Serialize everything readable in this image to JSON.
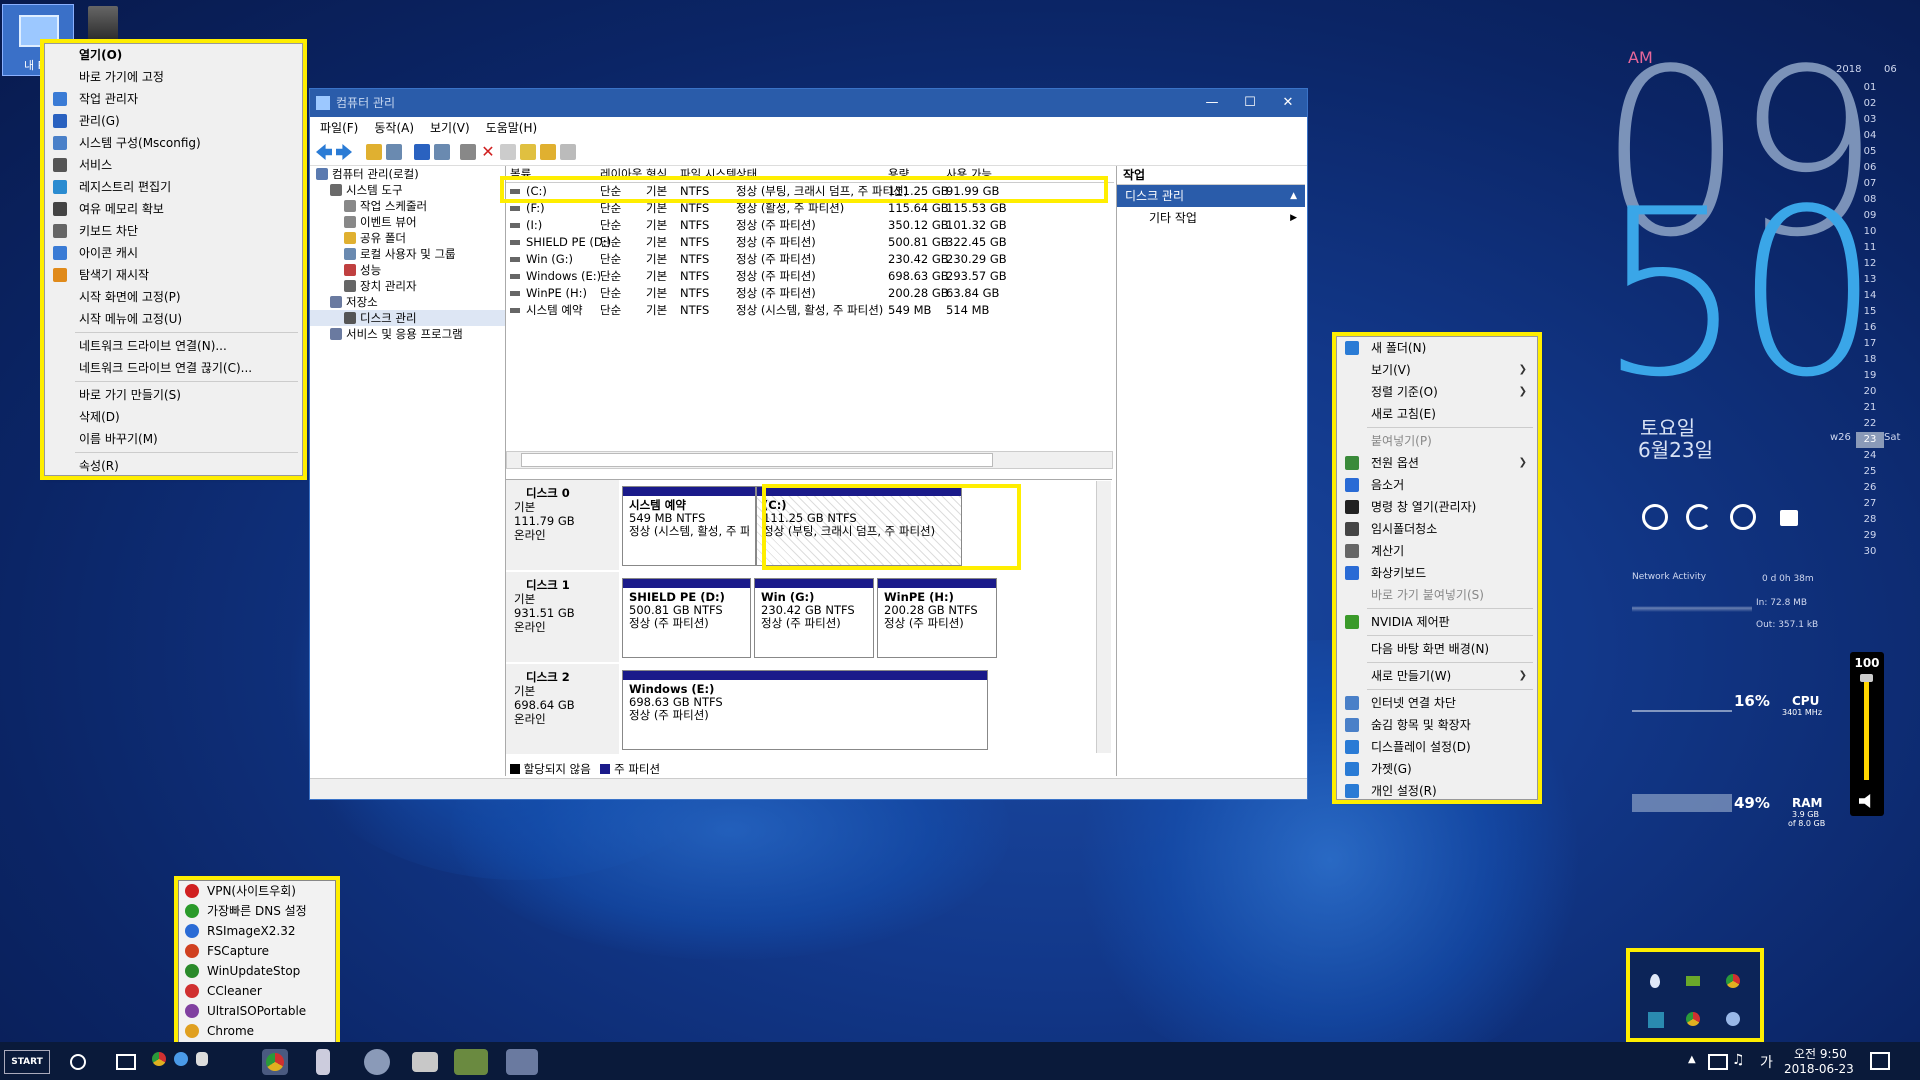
{
  "desktop": {
    "icon_label": "내 PC"
  },
  "left_menu": {
    "items": [
      {
        "label": "열기(O)",
        "bold": true
      },
      {
        "label": "바로 가기에 고정"
      },
      {
        "label": "작업 관리자",
        "icon_color": "#3a7bd5"
      },
      {
        "label": "관리(G)",
        "icon_color": "#2a62c0"
      },
      {
        "label": "시스템 구성(Msconfig)",
        "icon_color": "#4a80c8"
      },
      {
        "label": "서비스",
        "icon_color": "#555"
      },
      {
        "label": "레지스트리 편집기",
        "icon_color": "#2a8bd0"
      },
      {
        "label": "여유 메모리 확보",
        "icon_color": "#444"
      },
      {
        "label": "키보드 차단",
        "icon_color": "#666"
      },
      {
        "label": "아이콘 캐시",
        "icon_color": "#3a7bd5"
      },
      {
        "label": "탐색기 재시작",
        "icon_color": "#e08a1a"
      },
      {
        "label": "시작 화면에 고정(P)"
      },
      {
        "label": "시작 메뉴에 고정(U)"
      },
      {
        "sep": true
      },
      {
        "label": "네트워크 드라이브 연결(N)..."
      },
      {
        "label": "네트워크 드라이브 연결 끊기(C)..."
      },
      {
        "sep": true
      },
      {
        "label": "바로 가기 만들기(S)"
      },
      {
        "label": "삭제(D)"
      },
      {
        "label": "이름 바꾸기(M)"
      },
      {
        "sep": true
      },
      {
        "label": "속성(R)"
      }
    ]
  },
  "window": {
    "title": "컴퓨터 관리",
    "menu": [
      "파일(F)",
      "동작(A)",
      "보기(V)",
      "도움말(H)"
    ],
    "tree": [
      {
        "label": "컴퓨터 관리(로컬)",
        "indent": 0
      },
      {
        "label": "시스템 도구",
        "indent": 1
      },
      {
        "label": "작업 스케줄러",
        "indent": 2
      },
      {
        "label": "이벤트 뷰어",
        "indent": 2
      },
      {
        "label": "공유 폴더",
        "indent": 2
      },
      {
        "label": "로컬 사용자 및 그룹",
        "indent": 2
      },
      {
        "label": "성능",
        "indent": 2
      },
      {
        "label": "장치 관리자",
        "indent": 2
      },
      {
        "label": "저장소",
        "indent": 1
      },
      {
        "label": "디스크 관리",
        "indent": 2
      },
      {
        "label": "서비스 및 응용 프로그램",
        "indent": 1
      }
    ],
    "columns": [
      "볼륨",
      "레이아웃",
      "형식",
      "파일 시스템",
      "상태",
      "용량",
      "사용 가능"
    ],
    "volumes": [
      [
        "(C:)",
        "단순",
        "기본",
        "NTFS",
        "정상 (부팅, 크래시 덤프, 주 파티션)",
        "111.25 GB",
        "91.99 GB"
      ],
      [
        "(F:)",
        "단순",
        "기본",
        "NTFS",
        "정상 (활성, 주 파티션)",
        "115.64 GB",
        "115.53 GB"
      ],
      [
        "(I:)",
        "단순",
        "기본",
        "NTFS",
        "정상 (주 파티션)",
        "350.12 GB",
        "101.32 GB"
      ],
      [
        "SHIELD PE (D:)",
        "단순",
        "기본",
        "NTFS",
        "정상 (주 파티션)",
        "500.81 GB",
        "322.45 GB"
      ],
      [
        "Win (G:)",
        "단순",
        "기본",
        "NTFS",
        "정상 (주 파티션)",
        "230.42 GB",
        "230.29 GB"
      ],
      [
        "Windows (E:)",
        "단순",
        "기본",
        "NTFS",
        "정상 (주 파티션)",
        "698.63 GB",
        "293.57 GB"
      ],
      [
        "WinPE (H:)",
        "단순",
        "기본",
        "NTFS",
        "정상 (주 파티션)",
        "200.28 GB",
        "63.84 GB"
      ],
      [
        "시스템 예약",
        "단순",
        "기본",
        "NTFS",
        "정상 (시스템, 활성, 주 파티션)",
        "549 MB",
        "514 MB"
      ]
    ],
    "disks": [
      {
        "name": "디스크 0",
        "type": "기본",
        "size": "111.79 GB",
        "state": "온라인",
        "parts": [
          {
            "name": "시스템 예약",
            "size": "549 MB NTFS",
            "status": "정상 (시스템, 활성, 주 파"
          },
          {
            "name": "(C:)",
            "size": "111.25 GB NTFS",
            "status": "정상 (부팅, 크래시 덤프, 주 파티션)"
          }
        ]
      },
      {
        "name": "디스크 1",
        "type": "기본",
        "size": "931.51 GB",
        "state": "온라인",
        "parts": [
          {
            "name": "SHIELD PE  (D:)",
            "size": "500.81 GB NTFS",
            "status": "정상 (주 파티션)"
          },
          {
            "name": "Win  (G:)",
            "size": "230.42 GB NTFS",
            "status": "정상 (주 파티션)"
          },
          {
            "name": "WinPE  (H:)",
            "size": "200.28 GB NTFS",
            "status": "정상 (주 파티션)"
          }
        ]
      },
      {
        "name": "디스크 2",
        "type": "기본",
        "size": "698.64 GB",
        "state": "온라인",
        "parts": [
          {
            "name": "Windows  (E:)",
            "size": "698.63 GB NTFS",
            "status": "정상 (주 파티션)"
          }
        ]
      }
    ],
    "legend": [
      "할당되지 않음",
      "주 파티션"
    ],
    "actions": {
      "header": "작업",
      "section": "디스크 관리",
      "sub": "기타 작업"
    }
  },
  "right_menu": {
    "items": [
      {
        "label": "새 폴더(N)",
        "icon_color": "#2a7bd5"
      },
      {
        "label": "보기(V)",
        "arrow": true
      },
      {
        "label": "정렬 기준(O)",
        "arrow": true
      },
      {
        "label": "새로 고침(E)"
      },
      {
        "sep": true
      },
      {
        "label": "붙여넣기(P)",
        "disabled": true
      },
      {
        "label": "전원 옵션",
        "arrow": true,
        "icon_color": "#3a8a3a"
      },
      {
        "label": "음소거",
        "icon_color": "#2a6bd5"
      },
      {
        "label": "명령 창 열기(관리자)",
        "icon_color": "#222"
      },
      {
        "label": "임시폴더청소",
        "icon_color": "#444"
      },
      {
        "label": "계산기",
        "icon_color": "#666"
      },
      {
        "label": "화상키보드",
        "icon_color": "#2a6bd5"
      },
      {
        "label": "바로 가기 붙여넣기(S)",
        "disabled": true
      },
      {
        "sep": true
      },
      {
        "label": "NVIDIA 제어판",
        "icon_color": "#3a9a2a"
      },
      {
        "sep": true
      },
      {
        "label": "다음 바탕 화면 배경(N)"
      },
      {
        "sep": true
      },
      {
        "label": "새로 만들기(W)",
        "arrow": true
      },
      {
        "sep": true
      },
      {
        "label": "인터넷 연결 차단",
        "icon_color": "#4a80c8"
      },
      {
        "label": "숨김 항목 및 확장자",
        "icon_color": "#4a80c8"
      },
      {
        "label": "디스플레이 설정(D)",
        "icon_color": "#2a7bd5"
      },
      {
        "label": "가젯(G)",
        "icon_color": "#2a7bd5"
      },
      {
        "label": "개인 설정(R)",
        "icon_color": "#2a7bd5"
      }
    ]
  },
  "clock": {
    "ampm": "AM",
    "hour": "09",
    "minute": "50",
    "weekday": "토요일",
    "date": "6월23일"
  },
  "calendar": {
    "year": "2018",
    "month": "06",
    "week": "w26",
    "today": "23",
    "today_day": "Sat",
    "days": [
      "01",
      "02",
      "03",
      "04",
      "05",
      "06",
      "07",
      "08",
      "09",
      "10",
      "11",
      "12",
      "13",
      "14",
      "15",
      "16",
      "17",
      "18",
      "19",
      "20",
      "21",
      "22",
      "23",
      "24",
      "25",
      "26",
      "27",
      "28",
      "29",
      "30"
    ]
  },
  "network": {
    "title": "Network Activity",
    "uptime": "0 d 0h 38m",
    "in": "In: 72.8 MB",
    "out": "Out: 357.1 kB"
  },
  "cpu": {
    "percent": "16%",
    "label": "CPU",
    "freq": "3401 MHz"
  },
  "ram": {
    "percent": "49%",
    "label": "RAM",
    "detail1": "3.9 GB",
    "detail2": "of 8.0 GB"
  },
  "volume": {
    "value": "100",
    "level": 1.0
  },
  "quicklaunch": {
    "items": [
      {
        "label": "VPN(사이트우회)",
        "color": "#d02020"
      },
      {
        "label": "가장빠른 DNS 설정",
        "color": "#2a9a2a"
      },
      {
        "label": "RSImageX2.32",
        "color": "#2a6bd5"
      },
      {
        "label": "FSCapture",
        "color": "#d04020"
      },
      {
        "label": "WinUpdateStop",
        "color": "#2a8a2a"
      },
      {
        "label": "CCleaner",
        "color": "#d03030"
      },
      {
        "label": "UltraISOPortable",
        "color": "#8040a0"
      },
      {
        "label": "Chrome",
        "color": "#e0a020"
      }
    ]
  },
  "taskbar": {
    "start": "START",
    "time": "오전 9:50",
    "date": "2018-06-23",
    "ime": "가"
  }
}
